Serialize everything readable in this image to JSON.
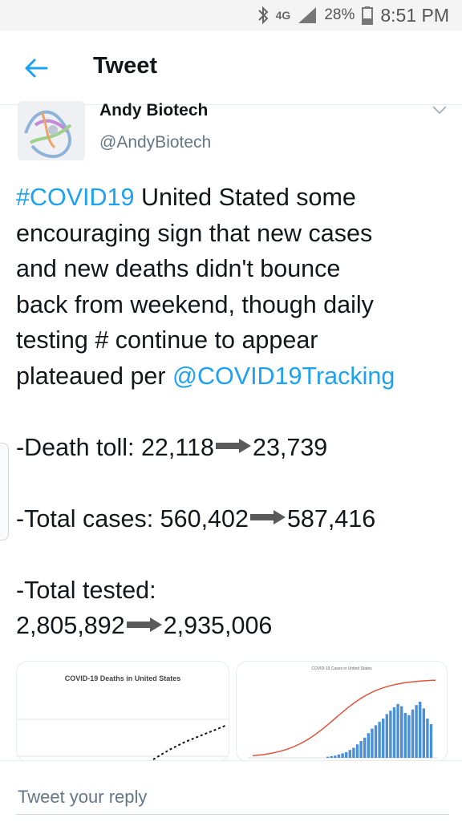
{
  "status_bar": {
    "network": "4G",
    "battery": "28%",
    "time": "8:51 PM"
  },
  "header": {
    "title": "Tweet"
  },
  "tweet": {
    "author_name": "Andy Biotech",
    "author_handle": "@AndyBiotech",
    "hashtag": "#COVID19",
    "line1_rest": " United Stated some",
    "line2": "encouraging sign that new cases",
    "line3": "and new deaths didn't bounce",
    "line4": "back from weekend, though daily",
    "line5": "testing # continue to appear",
    "line6_pre": "plateaued per ",
    "mention": "@COVID19Tracking",
    "death_label": "-Death toll:  22,118",
    "death_new": "23,739",
    "cases_label": "-Total cases:  560,402",
    "cases_new": "587,416",
    "tested_label": "-Total tested:",
    "tested_old": "2,805,892",
    "tested_new": "2,935,006"
  },
  "media": [
    {
      "title": "COVID-19 Deaths in United States"
    },
    {
      "title": "COVID-19 Cases in United States"
    }
  ],
  "reply": {
    "placeholder": "Tweet your reply"
  },
  "colors": {
    "link": "#1da1f2",
    "line_series": "#e0533d",
    "bar_series": "#4a90d9"
  }
}
